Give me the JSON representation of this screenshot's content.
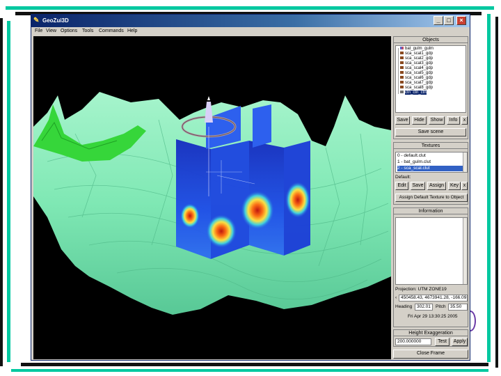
{
  "window": {
    "title": "GeoZui3D"
  },
  "menu": [
    "File",
    "View",
    "Options",
    "Tools",
    "Commands",
    "Help"
  ],
  "objects": {
    "header": "Objects",
    "items": [
      "bat_gulm_gulm",
      "sca_scal1_gdp",
      "sca_scal2_gdp",
      "sca_scal3_gdp",
      "sca_scal4_gdp",
      "sca_scal5_gdp",
      "sca_scal6_gdp",
      "sca_scal7_gdp",
      "sca_scal8_gdp",
      "ctn_ctn_ctn"
    ],
    "selected": "ctn_ctn_ctn",
    "buttons": {
      "save": "Save",
      "hide": "Hide",
      "show": "Show",
      "info": "Info",
      "close": "x"
    },
    "save_scene": "Save scene"
  },
  "textures": {
    "header": "Textures",
    "items": [
      "0 - default.clut",
      "1 - bat_gulm.clut",
      "2 - sca_scal.clut"
    ],
    "selected": "2 - sca_scal.clut",
    "default_label": "Default:",
    "buttons": {
      "edit": "Edit",
      "save": "Save",
      "assign": "Assign",
      "key": "Key",
      "close": "x"
    },
    "assign_default": "Assign Default Texture to Object"
  },
  "information": {
    "header": "Information",
    "projection": "Projection:  UTM ZONE19",
    "coords": "450458.43, 4673941.28, -166.09",
    "heading_label": "Heading",
    "heading_value": "302.01",
    "pitch_label": "Pitch",
    "pitch_value": "35.50",
    "datetime": "Fri Apr 29 13:30:25 2005"
  },
  "height": {
    "header": "Height Exaggeration",
    "value": "200.000000",
    "test": "Test",
    "apply": "Apply"
  },
  "close_frame": "Close Frame",
  "colors": {
    "terrain": "#7fe8b4",
    "terrain_highlight": "#36d63a",
    "slice_blue": "#1c3fd8",
    "slice_hot": "#e02010",
    "viewport_bg": "#000000",
    "selection": "#0a246a"
  }
}
